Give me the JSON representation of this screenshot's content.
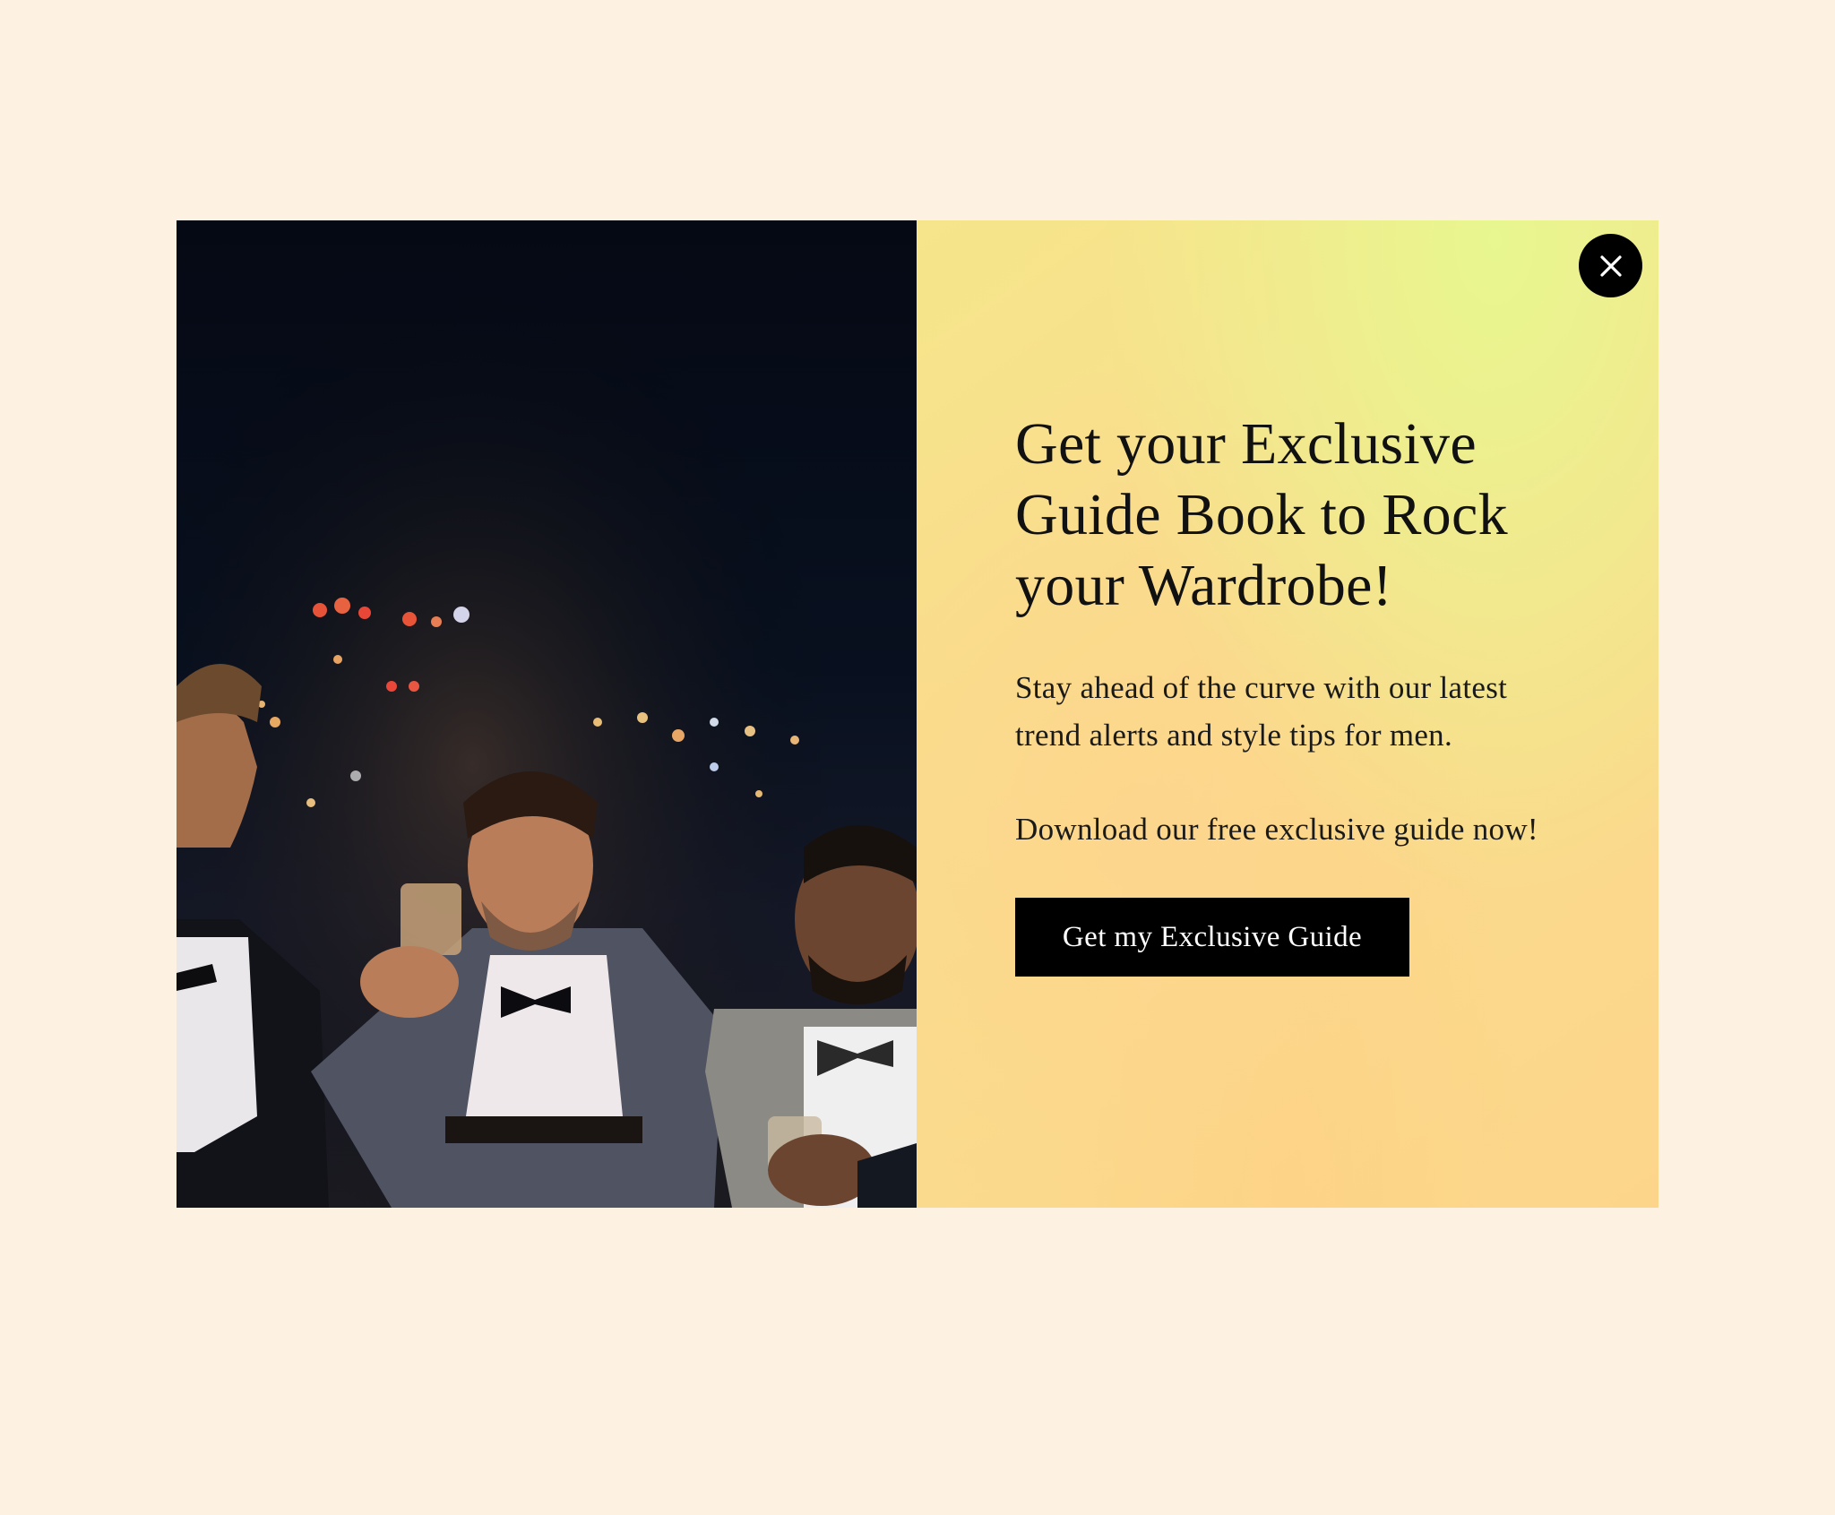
{
  "popup": {
    "headline": "Get your Exclusive Guide Book to Rock your Wardrobe!",
    "paragraph_1": "Stay ahead of the curve with our latest trend alerts and style tips for men.",
    "paragraph_2": "Download our free exclusive guide now!",
    "cta_label": "Get my Exclusive Guide",
    "close_icon": "close-icon",
    "image_alt": "Three smiling men in suits and bow ties holding whiskey glasses at night with city lights behind"
  },
  "colors": {
    "page_background": "#fdf2e2",
    "panel_gradient_top_right": "#e8f78f",
    "panel_gradient_bottom": "#fcd58a",
    "button_background": "#000000",
    "button_text": "#ffffff",
    "heading_text": "#111111"
  }
}
